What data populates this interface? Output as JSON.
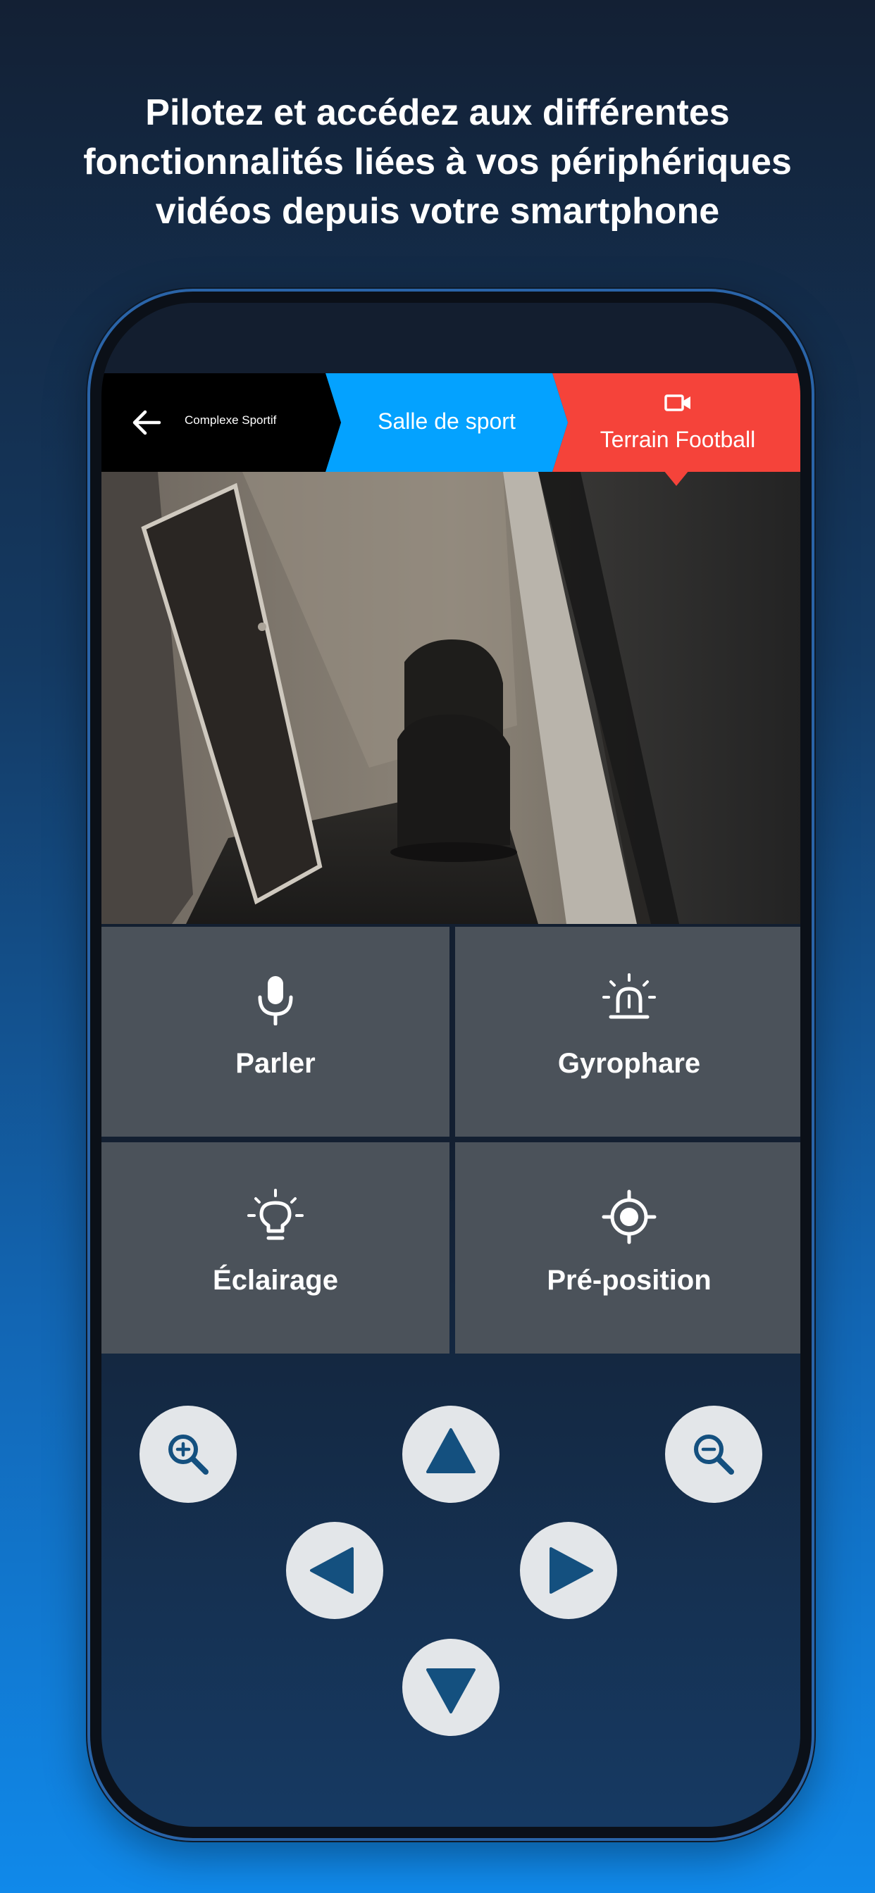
{
  "headline": {
    "line1": "Pilotez et accédez aux différentes",
    "line2": "fonctionnalités liées à vos périphériques",
    "line3": "vidéos depuis votre smartphone"
  },
  "breadcrumb": {
    "back_icon": "arrow-left-icon",
    "root": "Complexe Sportif",
    "middle": "Salle de sport",
    "active": "Terrain Football",
    "active_icon": "video-camera-icon",
    "colors": {
      "root": "#000000",
      "middle": "#04a2ff",
      "active": "#f5433a"
    }
  },
  "actions": [
    {
      "label": "Parler",
      "icon": "microphone-icon"
    },
    {
      "label": "Gyrophare",
      "icon": "siren-icon"
    },
    {
      "label": "Éclairage",
      "icon": "lightbulb-icon"
    },
    {
      "label": "Pré-position",
      "icon": "target-icon"
    }
  ],
  "controls": {
    "zoom_in": "zoom-in-icon",
    "zoom_out": "zoom-out-icon",
    "up": "arrow-up-icon",
    "down": "arrow-down-icon",
    "left": "arrow-left-icon",
    "right": "arrow-right-icon",
    "icon_color": "#14507f",
    "button_color": "#e3e6e9"
  }
}
